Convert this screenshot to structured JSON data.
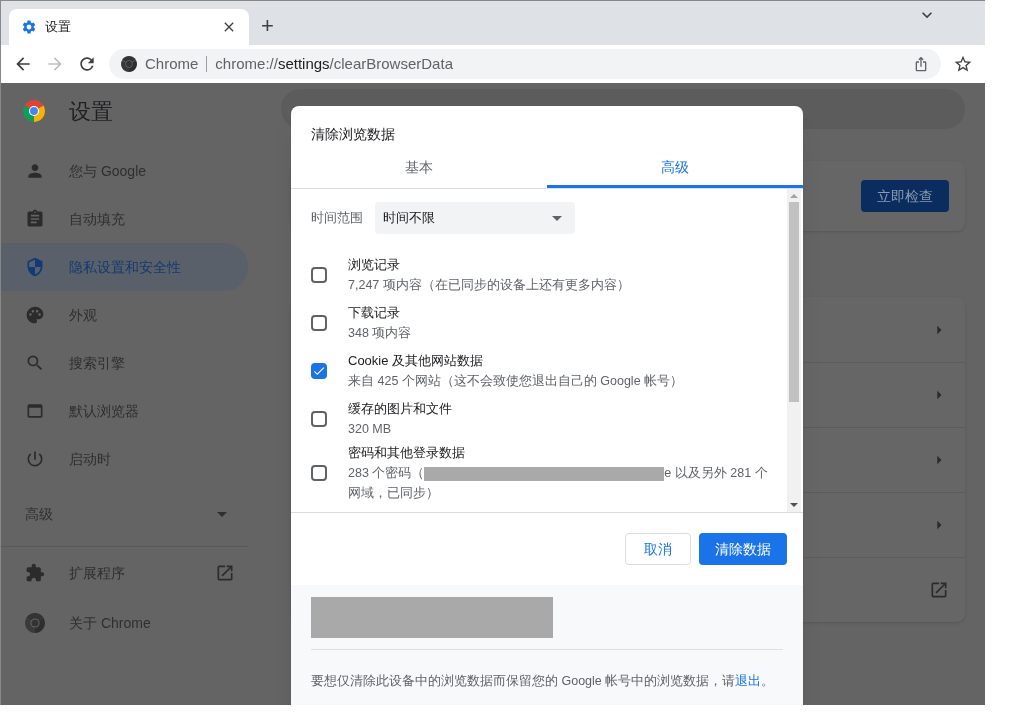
{
  "tab": {
    "title": "设置",
    "new_tab": "+"
  },
  "address": {
    "site": "Chrome",
    "url_prefix": "chrome://",
    "url_host": "settings",
    "url_path": "/clearBrowserData"
  },
  "settings": {
    "title": "设置",
    "nav": [
      {
        "label": "您与 Google",
        "kind": "person",
        "selected": false
      },
      {
        "label": "自动填充",
        "kind": "clipboard",
        "selected": false
      },
      {
        "label": "隐私设置和安全性",
        "kind": "shield",
        "selected": true
      },
      {
        "label": "外观",
        "kind": "palette",
        "selected": false
      },
      {
        "label": "搜索引擎",
        "kind": "search",
        "selected": false
      },
      {
        "label": "默认浏览器",
        "kind": "browser",
        "selected": false
      },
      {
        "label": "启动时",
        "kind": "power",
        "selected": false
      }
    ],
    "advanced": {
      "label": "高级",
      "expanded": false
    },
    "links": [
      {
        "label": "扩展程序",
        "kind": "puzzle",
        "external": true
      },
      {
        "label": "关于 Chrome",
        "kind": "chrome",
        "external": false
      }
    ]
  },
  "safety_check": {
    "button": "立即检查"
  },
  "cards": [
    {
      "kind": "arrow"
    },
    {
      "kind": "arrow"
    },
    {
      "kind": "arrow"
    },
    {
      "kind": "arrow"
    },
    {
      "kind": "external"
    }
  ],
  "dialog": {
    "title": "清除浏览数据",
    "tabs": [
      {
        "label": "基本",
        "selected": false
      },
      {
        "label": "高级",
        "selected": true
      }
    ],
    "time_range": {
      "label": "时间范围",
      "value": "时间不限"
    },
    "items": [
      {
        "title": "浏览记录",
        "detail": "7,247 项内容（在已同步的设备上还有更多内容）",
        "checked": false
      },
      {
        "title": "下载记录",
        "detail": "348 项内容",
        "checked": false
      },
      {
        "title": "Cookie 及其他网站数据",
        "detail": "来自 425 个网站（这不会致使您退出自己的 Google 帐号）",
        "checked": true
      },
      {
        "title": "缓存的图片和文件",
        "detail": "320 MB",
        "checked": false
      },
      {
        "title": "密码和其他登录数据",
        "detail": "283 个密码（",
        "redacted": true,
        "detail_after": "e 以及另外 281 个网域，已同步）",
        "checked": false
      }
    ],
    "buttons": {
      "cancel": "取消",
      "confirm": "清除数据"
    },
    "account_redacted": true,
    "footer": {
      "text": "要想仅清除此设备中的浏览数据而保留您的 Google 帐号中的浏览数据，请",
      "link": "退出",
      "end": "。"
    }
  }
}
